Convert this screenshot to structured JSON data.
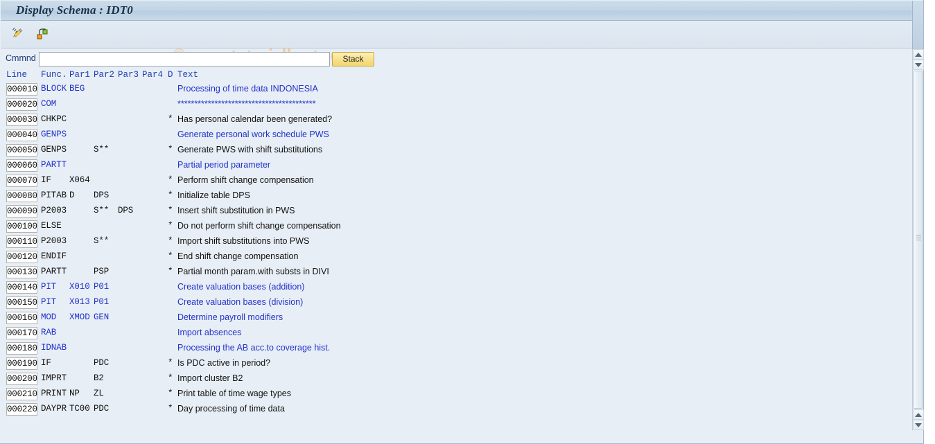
{
  "window": {
    "title": "Display Schema : IDT0",
    "watermark": "© www.tutorialkart.com"
  },
  "toolbar": {
    "buttons": [
      {
        "name": "edit-schema-icon",
        "tooltip": "Change"
      },
      {
        "name": "hierarchy-icon",
        "tooltip": "Structure"
      }
    ]
  },
  "command": {
    "label": "Cmmnd",
    "value": "",
    "placeholder": "",
    "stack_label": "Stack"
  },
  "grid": {
    "headers": {
      "line": "Line",
      "func": "Func.",
      "par1": "Par1",
      "par2": "Par2",
      "par3": "Par3",
      "par4": "Par4",
      "d": "D",
      "text": "Text"
    },
    "rows": [
      {
        "line": "000010",
        "func": "BLOCK",
        "par1": "BEG",
        "par2": "",
        "par3": "",
        "par4": "",
        "d": "",
        "text": "Processing of time data INDONESIA",
        "blue": true
      },
      {
        "line": "000020",
        "func": "COM",
        "par1": "",
        "par2": "",
        "par3": "",
        "par4": "",
        "d": "",
        "text": "*****************************************",
        "blue": true
      },
      {
        "line": "000030",
        "func": "CHKPC",
        "par1": "",
        "par2": "",
        "par3": "",
        "par4": "",
        "d": "*",
        "text": "Has personal calendar been generated?",
        "blue": false
      },
      {
        "line": "000040",
        "func": "GENPS",
        "par1": "",
        "par2": "",
        "par3": "",
        "par4": "",
        "d": "",
        "text": "Generate personal work schedule PWS",
        "blue": true
      },
      {
        "line": "000050",
        "func": "GENPS",
        "par1": "",
        "par2": "S**",
        "par3": "",
        "par4": "",
        "d": "*",
        "text": "Generate PWS with shift substitutions",
        "blue": false
      },
      {
        "line": "000060",
        "func": "PARTT",
        "par1": "",
        "par2": "",
        "par3": "",
        "par4": "",
        "d": "",
        "text": "Partial period parameter",
        "blue": true
      },
      {
        "line": "000070",
        "func": "IF",
        "par1": "X064",
        "par2": "",
        "par3": "",
        "par4": "",
        "d": "*",
        "text": "Perform shift change compensation",
        "blue": false
      },
      {
        "line": "000080",
        "func": "PITAB",
        "par1": "D",
        "par2": "DPS",
        "par3": "",
        "par4": "",
        "d": "*",
        "text": "Initialize table DPS",
        "blue": false
      },
      {
        "line": "000090",
        "func": "P2003",
        "par1": "",
        "par2": "S**",
        "par3": "DPS",
        "par4": "",
        "d": "*",
        "text": "Insert shift substitution in PWS",
        "blue": false
      },
      {
        "line": "000100",
        "func": "ELSE",
        "par1": "",
        "par2": "",
        "par3": "",
        "par4": "",
        "d": "*",
        "text": "Do not perform shift change compensation",
        "blue": false
      },
      {
        "line": "000110",
        "func": "P2003",
        "par1": "",
        "par2": "S**",
        "par3": "",
        "par4": "",
        "d": "*",
        "text": "Import shift substitutions into PWS",
        "blue": false
      },
      {
        "line": "000120",
        "func": "ENDIF",
        "par1": "",
        "par2": "",
        "par3": "",
        "par4": "",
        "d": "*",
        "text": "End shift change compensation",
        "blue": false
      },
      {
        "line": "000130",
        "func": "PARTT",
        "par1": "",
        "par2": "PSP",
        "par3": "",
        "par4": "",
        "d": "*",
        "text": "Partial month param.with substs in DIVI",
        "blue": false
      },
      {
        "line": "000140",
        "func": "PIT",
        "par1": "X010",
        "par2": "P01",
        "par3": "",
        "par4": "",
        "d": "",
        "text": "Create valuation bases (addition)",
        "blue": true
      },
      {
        "line": "000150",
        "func": "PIT",
        "par1": "X013",
        "par2": "P01",
        "par3": "",
        "par4": "",
        "d": "",
        "text": "Create valuation bases (division)",
        "blue": true
      },
      {
        "line": "000160",
        "func": "MOD",
        "par1": "XMOD",
        "par2": "GEN",
        "par3": "",
        "par4": "",
        "d": "",
        "text": "Determine payroll modifiers",
        "blue": true
      },
      {
        "line": "000170",
        "func": "RAB",
        "par1": "",
        "par2": "",
        "par3": "",
        "par4": "",
        "d": "",
        "text": "Import absences",
        "blue": true
      },
      {
        "line": "000180",
        "func": "IDNAB",
        "par1": "",
        "par2": "",
        "par3": "",
        "par4": "",
        "d": "",
        "text": "Processing the AB acc.to coverage hist.",
        "blue": true
      },
      {
        "line": "000190",
        "func": "IF",
        "par1": "",
        "par2": "PDC",
        "par3": "",
        "par4": "",
        "d": "*",
        "text": "Is PDC active in period?",
        "blue": false
      },
      {
        "line": "000200",
        "func": "IMPRT",
        "par1": "",
        "par2": "B2",
        "par3": "",
        "par4": "",
        "d": "*",
        "text": "Import cluster B2",
        "blue": false
      },
      {
        "line": "000210",
        "func": "PRINT",
        "par1": "NP",
        "par2": "ZL",
        "par3": "",
        "par4": "",
        "d": "*",
        "text": "Print table of time wage types",
        "blue": false
      },
      {
        "line": "000220",
        "func": "DAYPR",
        "par1": "TC00",
        "par2": "PDC",
        "par3": "",
        "par4": "",
        "d": "*",
        "text": "Day processing of time data",
        "blue": false
      }
    ]
  },
  "scrollbars": {
    "vertical_top_up": "scroll-up",
    "vertical_top_down": "scroll-down",
    "vertical_bottom_up": "scroll-up",
    "vertical_bottom_down": "scroll-down"
  }
}
